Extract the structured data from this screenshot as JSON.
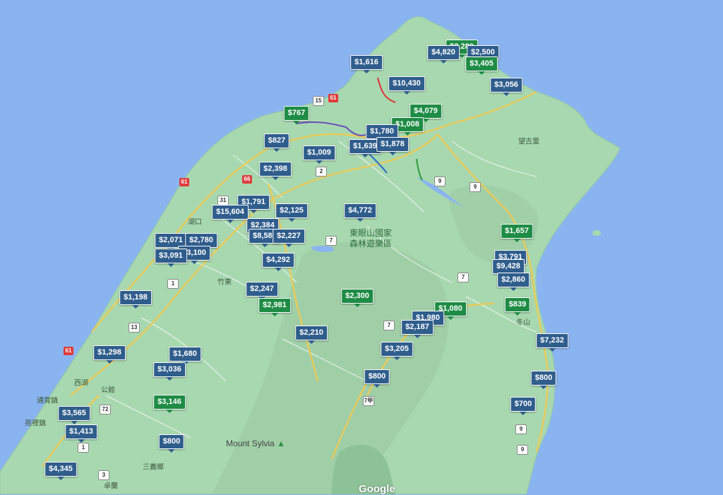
{
  "map": {
    "colors": {
      "water": "#8ab4f0",
      "land": "#a8d8b0",
      "road_major": "#f6c94a",
      "road_minor": "#ffffff",
      "pin_blue": "#2f5d8c",
      "pin_green": "#1e8c45"
    },
    "place_labels": [
      "東眼山國家",
      "森林遊樂區",
      "湖口",
      "竹東",
      "西湖",
      "公館",
      "通霄鎮",
      "苑裡鎮",
      "望古里",
      "冬山",
      "三義鄉",
      "卓蘭"
    ],
    "mountain_label": "Mount Sylvia",
    "logo_text": "Google"
  },
  "pins": [
    {
      "price": "$2,280",
      "color": "green"
    },
    {
      "price": "$4,820",
      "color": "blue"
    },
    {
      "price": "$2,500",
      "color": "blue"
    },
    {
      "price": "$3,405",
      "color": "green"
    },
    {
      "price": "$1,616",
      "color": "blue"
    },
    {
      "price": "$10,430",
      "color": "blue"
    },
    {
      "price": "$3,056",
      "color": "blue"
    },
    {
      "price": "$767",
      "color": "green"
    },
    {
      "price": "$4,079",
      "color": "green"
    },
    {
      "price": "$1,008",
      "color": "green"
    },
    {
      "price": "$1,780",
      "color": "blue"
    },
    {
      "price": "$827",
      "color": "blue"
    },
    {
      "price": "$1,009",
      "color": "blue"
    },
    {
      "price": "$1,639",
      "color": "blue"
    },
    {
      "price": "$1,878",
      "color": "blue"
    },
    {
      "price": "$2,398",
      "color": "blue"
    },
    {
      "price": "$1,791",
      "color": "blue"
    },
    {
      "price": "$15,604",
      "color": "blue"
    },
    {
      "price": "$2,125",
      "color": "blue"
    },
    {
      "price": "$4,772",
      "color": "blue"
    },
    {
      "price": "$2,384",
      "color": "blue"
    },
    {
      "price": "$8,580",
      "color": "blue"
    },
    {
      "price": "$2,227",
      "color": "blue"
    },
    {
      "price": "$2,071",
      "color": "blue"
    },
    {
      "price": "$2,780",
      "color": "blue"
    },
    {
      "price": "$3,100",
      "color": "blue"
    },
    {
      "price": "$3,091",
      "color": "blue"
    },
    {
      "price": "$4,292",
      "color": "blue"
    },
    {
      "price": "$1,657",
      "color": "green"
    },
    {
      "price": "$3,791",
      "color": "blue"
    },
    {
      "price": "$9,428",
      "color": "blue"
    },
    {
      "price": "$2,860",
      "color": "blue"
    },
    {
      "price": "$2,247",
      "color": "blue"
    },
    {
      "price": "$1,198",
      "color": "blue"
    },
    {
      "price": "$2,981",
      "color": "green"
    },
    {
      "price": "$2,300",
      "color": "green"
    },
    {
      "price": "$1,080",
      "color": "green"
    },
    {
      "price": "$1,980",
      "color": "blue"
    },
    {
      "price": "$839",
      "color": "green"
    },
    {
      "price": "$2,187",
      "color": "blue"
    },
    {
      "price": "$2,210",
      "color": "blue"
    },
    {
      "price": "$7,232",
      "color": "blue"
    },
    {
      "price": "$1,298",
      "color": "blue"
    },
    {
      "price": "$1,680",
      "color": "blue"
    },
    {
      "price": "$3,205",
      "color": "blue"
    },
    {
      "price": "$3,036",
      "color": "blue"
    },
    {
      "price": "$800",
      "color": "blue"
    },
    {
      "price": "$800",
      "color": "blue"
    },
    {
      "price": "$3,146",
      "color": "green"
    },
    {
      "price": "$700",
      "color": "blue"
    },
    {
      "price": "$3,565",
      "color": "blue"
    },
    {
      "price": "$1,413",
      "color": "blue"
    },
    {
      "price": "$800",
      "color": "blue"
    },
    {
      "price": "$4,345",
      "color": "blue"
    }
  ]
}
